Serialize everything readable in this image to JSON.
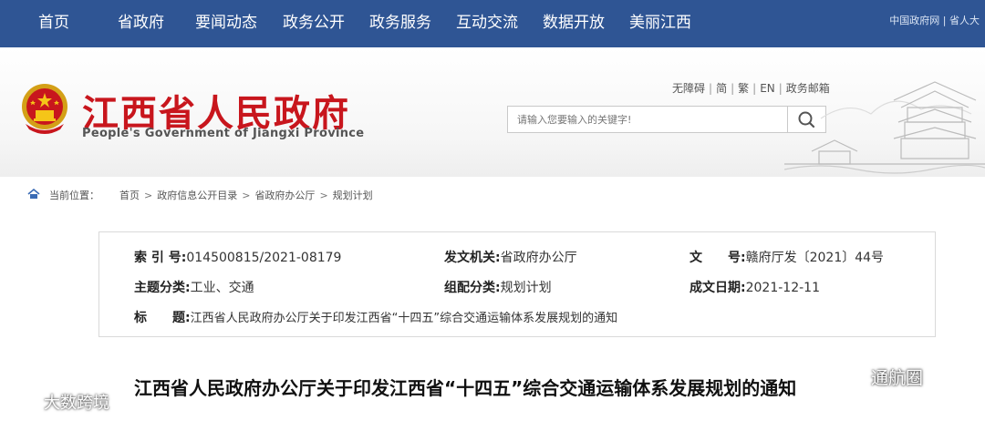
{
  "topnav": {
    "items": [
      "首页",
      "省政府",
      "要闻动态",
      "政务公开",
      "政务服务",
      "互动交流",
      "数据开放",
      "美丽江西"
    ],
    "right_links": "中国政府网 | 省人大",
    "bg_color": "#2f5594"
  },
  "header": {
    "site_title": "江西省人民政府",
    "site_subtitle": "People's Government of Jiangxi Province",
    "title_color": "#c8161d",
    "util_links": [
      "无障碍",
      "简",
      "繁",
      "EN",
      "政务邮箱"
    ],
    "search_placeholder": "请输入您要输入的关键字!",
    "search_icon": "search-icon",
    "emblem_icon": "national-emblem-icon"
  },
  "breadcrumb": {
    "prefix": "当前位置：",
    "icon": "home-icon",
    "items": [
      "首页",
      "政府信息公开目录",
      "省政府办公厅",
      "规划计划"
    ]
  },
  "info": {
    "index_label": "索 引 号:",
    "index_value": "014500815/2021-08179",
    "issuer_label": "发文机关:",
    "issuer_value": "省政府办公厅",
    "docno_label": "文　　号:",
    "docno_value": "赣府厅发〔2021〕44号",
    "topic_label": "主题分类:",
    "topic_value": "工业、交通",
    "category_label": "组配分类:",
    "category_value": "规划计划",
    "date_label": "成文日期:",
    "date_value": "2021-12-11",
    "title_label": "标　　题:",
    "title_value": "江西省人民政府办公厅关于印发江西省“十四五”综合交通运输体系发展规划的通知"
  },
  "article": {
    "title": "江西省人民政府办公厅关于印发江西省“十四五”综合交通运输体系发展规划的通知"
  },
  "watermarks": {
    "right": "通航圈",
    "left": "大数跨境"
  }
}
